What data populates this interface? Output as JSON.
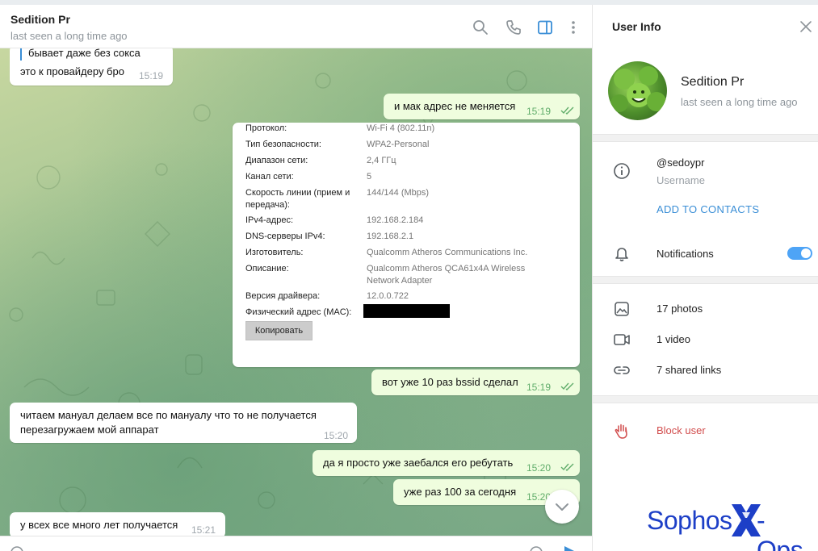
{
  "chat": {
    "title": "Sedition Pr",
    "status": "last seen a long time ago",
    "messages": [
      {
        "quote": "бывает даже без сокса",
        "text": "это к провайдеру бро",
        "time": "15:19"
      },
      {
        "text": "и мак адрес не меняется",
        "time": "15:19"
      },
      {
        "text": "вот уже 10 раз bssid сделал",
        "time": "15:19"
      },
      {
        "text_line1": "читаем мануал делаем все по мануалу что то не получается",
        "text_line2": "перезагружаем мой аппарат",
        "time": "15:20"
      },
      {
        "text": "да я просто уже заебался его ребутать",
        "time": "15:20"
      },
      {
        "text": "уже раз 100 за сегодня",
        "time": "15:20"
      },
      {
        "text": "у всех все много лет получается",
        "time": "15:21"
      }
    ],
    "network_card": {
      "rows": [
        {
          "key": "Протокол:",
          "value": "Wi-Fi 4 (802.11n)"
        },
        {
          "key": "Тип безопасности:",
          "value": "WPA2-Personal"
        },
        {
          "key": "Диапазон сети:",
          "value": "2,4 ГГц"
        },
        {
          "key": "Канал сети:",
          "value": "5"
        },
        {
          "key_line1": "Скорость линии (прием и",
          "key_line2": "передача):",
          "value": "144/144 (Mbps)"
        },
        {
          "key": "IPv4-адрес:",
          "value": "192.168.2.184"
        },
        {
          "key": "DNS-серверы IPv4:",
          "value": "192.168.2.1"
        },
        {
          "key": "Изготовитель:",
          "value": "Qualcomm Atheros Communications Inc."
        },
        {
          "key": "Описание:",
          "value_line1": "Qualcomm Atheros QCA61x4A Wireless",
          "value_line2": "Network Adapter"
        },
        {
          "key": "Версия драйвера:",
          "value": "12.0.0.722"
        },
        {
          "key": "Физический адрес (MAC):",
          "value": ""
        }
      ],
      "copy_label": "Копировать"
    }
  },
  "panel": {
    "title": "User Info",
    "name": "Sedition Pr",
    "status": "last seen a long time ago",
    "username": "@sedoypr",
    "username_label": "Username",
    "add_contacts": "ADD TO CONTACTS",
    "notifications_label": "Notifications",
    "notifications_on": true,
    "media": [
      {
        "icon": "photo-icon",
        "label": "17 photos"
      },
      {
        "icon": "video-icon",
        "label": "1 video"
      },
      {
        "icon": "link-icon",
        "label": "7 shared links"
      }
    ],
    "block_label": "Block user"
  },
  "watermark": {
    "part1": "Sophos",
    "part2": "-Ops"
  },
  "colors": {
    "accent": "#3a8ed6",
    "out_bubble": "#effdde",
    "danger": "#d14c4c",
    "brand": "#1d3fc7"
  }
}
